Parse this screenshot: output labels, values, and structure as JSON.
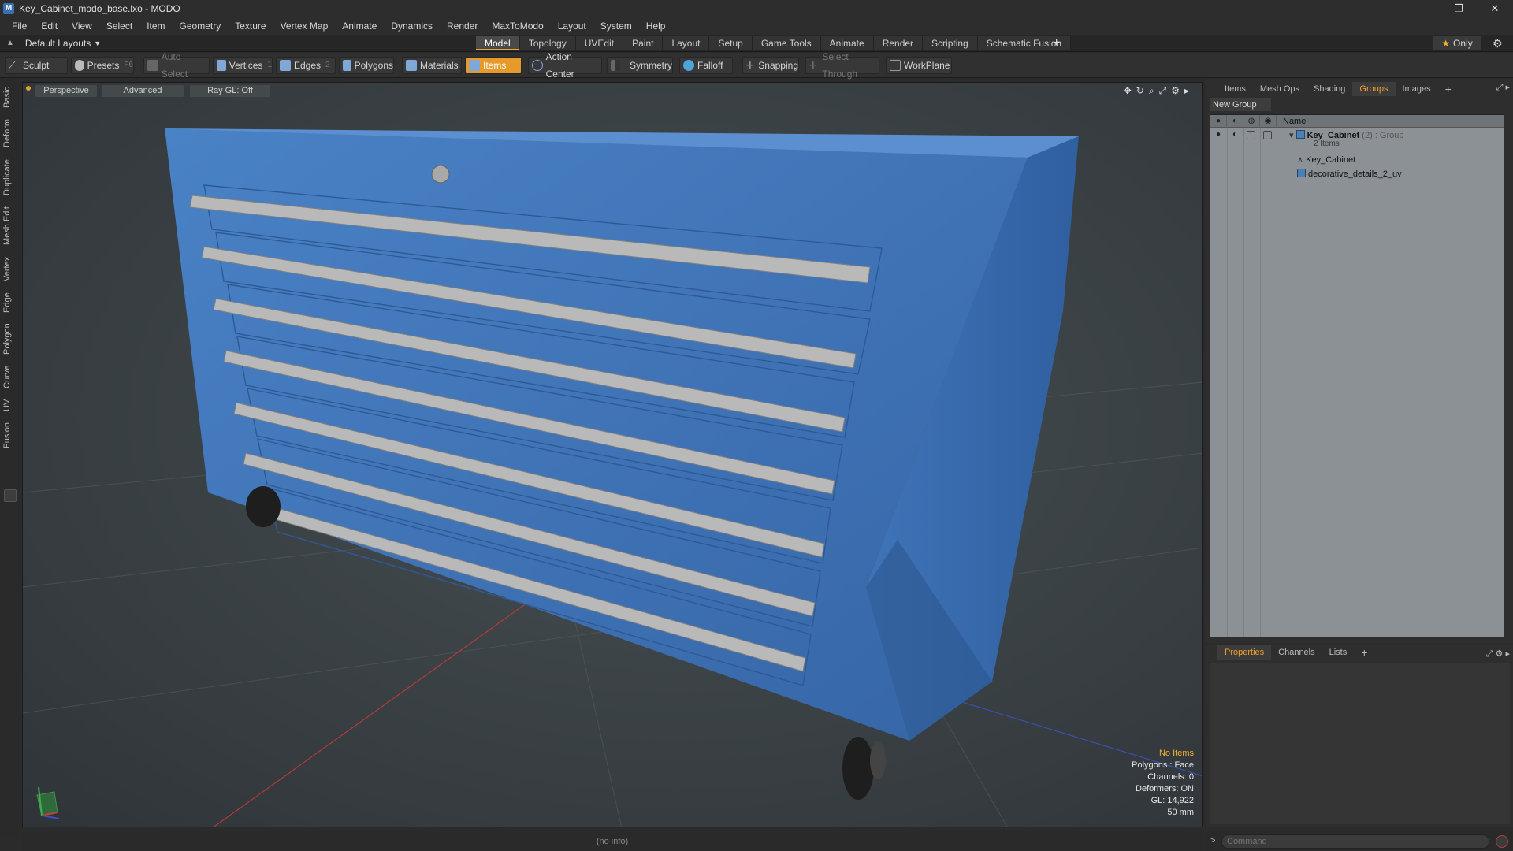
{
  "window": {
    "title": "Key_Cabinet_modo_base.lxo - MODO",
    "controls": [
      "–",
      "❐",
      "✕"
    ]
  },
  "menu": [
    "File",
    "Edit",
    "View",
    "Select",
    "Item",
    "Geometry",
    "Texture",
    "Vertex Map",
    "Animate",
    "Dynamics",
    "Render",
    "MaxToModo",
    "Layout",
    "System",
    "Help"
  ],
  "layoutbar": {
    "layout_name": "Default Layouts",
    "tabs": [
      "Model",
      "Topology",
      "UVEdit",
      "Paint",
      "Layout",
      "Setup",
      "Game Tools",
      "Animate",
      "Render",
      "Scripting",
      "Schematic Fusion"
    ],
    "active_tab": "Model",
    "plus": "+",
    "only_label": "Only"
  },
  "toolbar": {
    "sculpt": "Sculpt",
    "presets": "Presets",
    "presets_hotkey": "F6",
    "auto_select": "Auto Select",
    "vertices": "Vertices",
    "vertices_count": "1",
    "edges": "Edges",
    "edges_count": "2",
    "polygons": "Polygons",
    "materials": "Materials",
    "items": "Items",
    "action_center": "Action Center",
    "symmetry": "Symmetry",
    "falloff": "Falloff",
    "snapping": "Snapping",
    "select_through": "Select Through",
    "workplane": "WorkPlane"
  },
  "left_tabs": [
    "Basic",
    "Deform",
    "Duplicate",
    "Mesh Edit",
    "Vertex",
    "Edge",
    "Polygon",
    "Curve",
    "UV",
    "Fusion"
  ],
  "viewport": {
    "view_mode": "Perspective",
    "shading": "Advanced",
    "raygl": "Ray GL: Off",
    "stats": {
      "selection": "No Items",
      "polygons": "Polygons : Face",
      "channels": "Channels: 0",
      "deformers": "Deformers: ON",
      "gl": "GL: 14,922",
      "scale": "50 mm"
    }
  },
  "status_text": "(no info)",
  "right_panel": {
    "tabs": [
      "Items",
      "Mesh Ops",
      "Shading",
      "Groups",
      "Images",
      "+"
    ],
    "active_tab": "Groups",
    "new_group_label": "New Group",
    "tree_header": "Name",
    "group": {
      "name": "Key_Cabinet",
      "count": "(2)",
      "type": ": Group",
      "items_label": "2 Items"
    },
    "children": [
      "Key_Cabinet",
      "decorative_details_2_uv"
    ]
  },
  "prop_panel": {
    "tabs": [
      "Properties",
      "Channels",
      "Lists",
      "+"
    ],
    "active_tab": "Properties"
  },
  "command": {
    "placeholder": "Command",
    "prompt": ">"
  },
  "colors": {
    "accent": "#e59a2a",
    "cabinet_blue": "#3f72b6",
    "handle_gray": "#b7b7b7"
  }
}
